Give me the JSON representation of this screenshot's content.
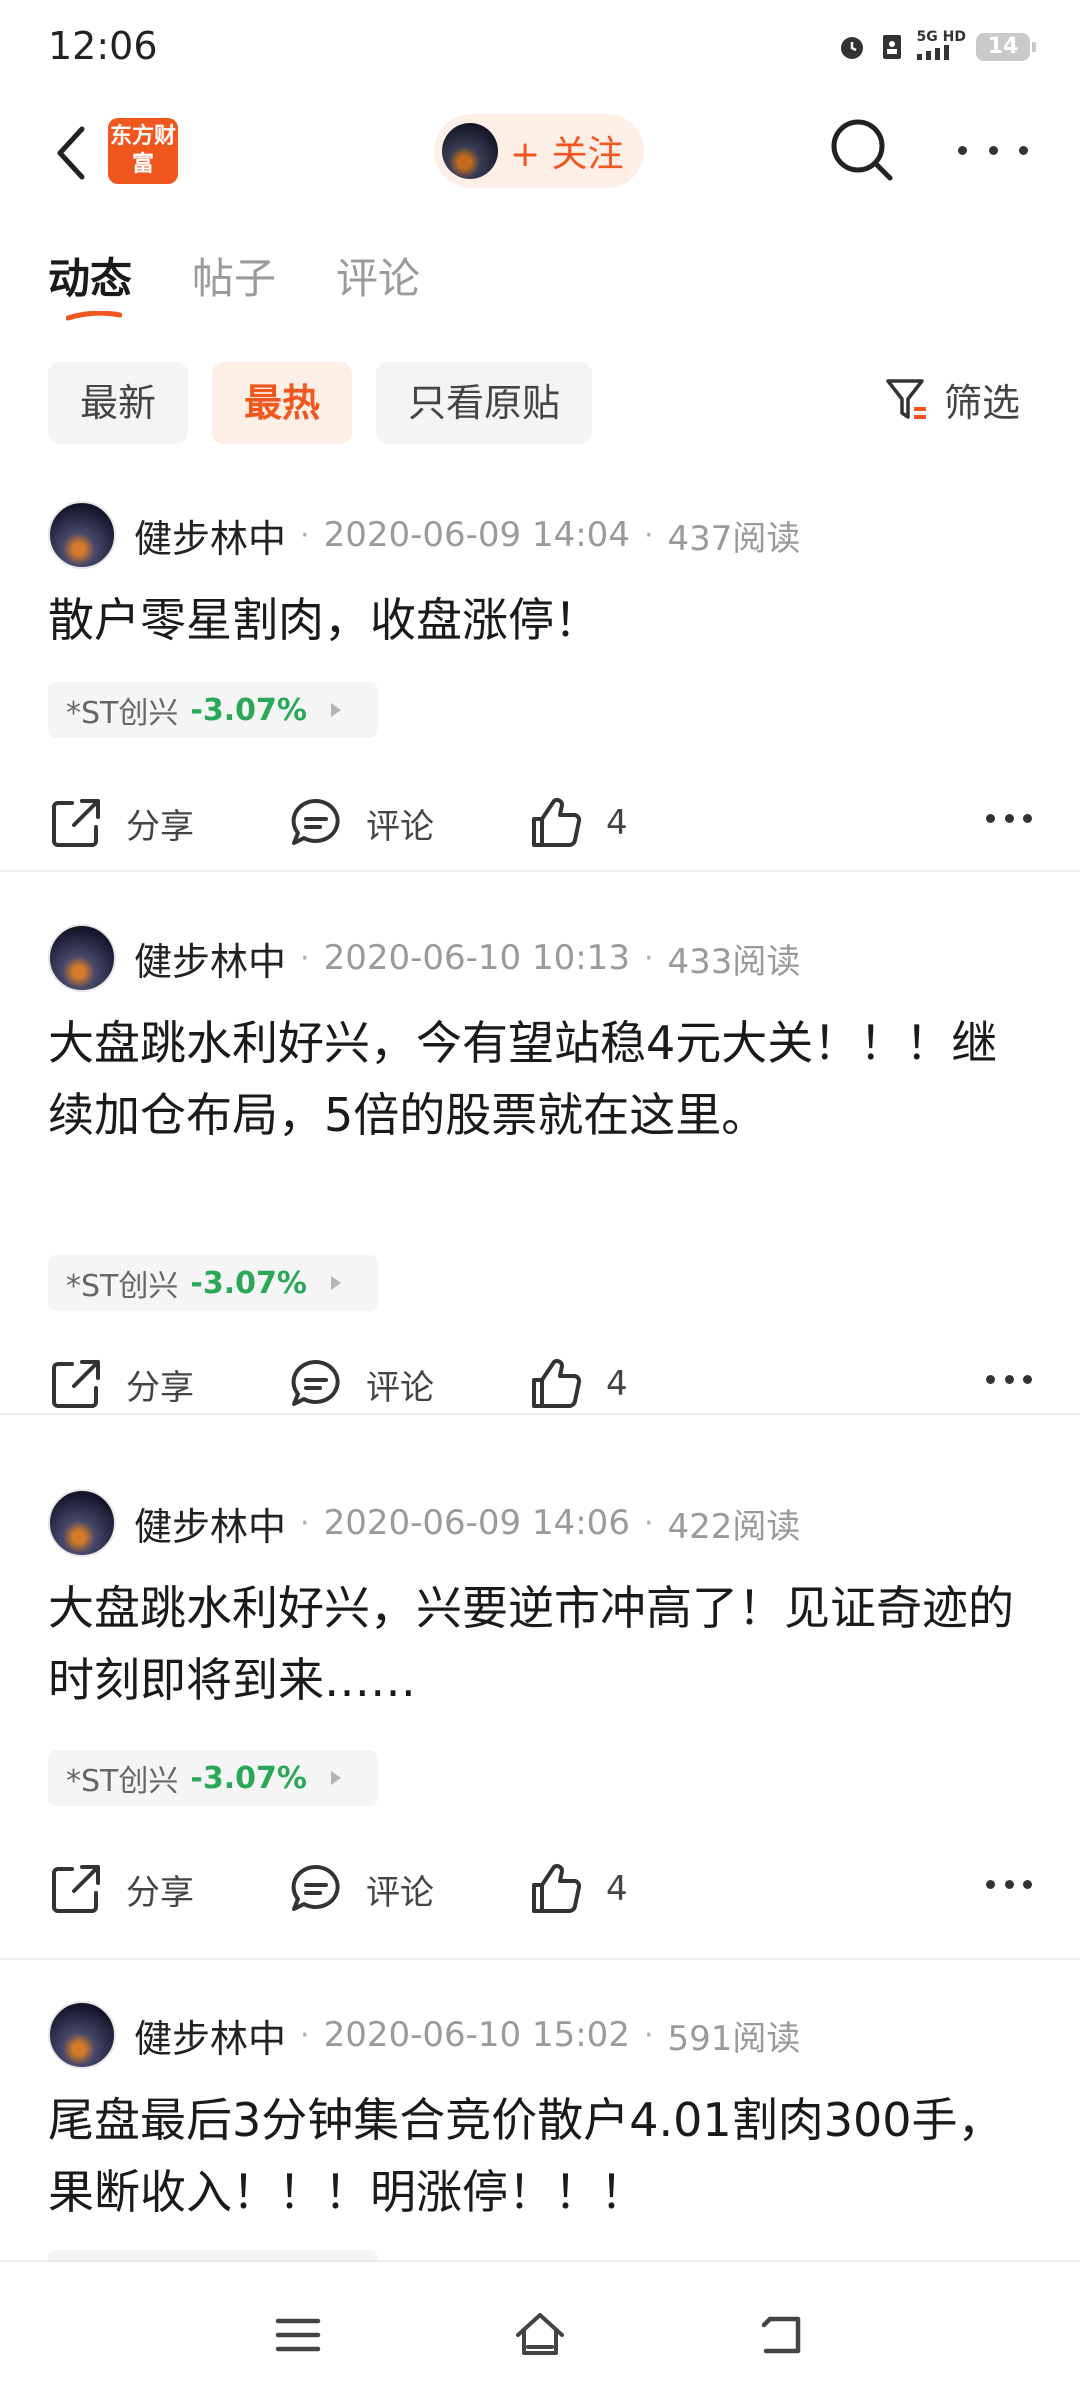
{
  "status_bar": {
    "time": "12:06",
    "network": "5G HD",
    "battery": "14"
  },
  "app_bar": {
    "logo_text": "东方财富",
    "follow_label": "+ 关注"
  },
  "main_tabs": [
    {
      "label": "动态",
      "active": true
    },
    {
      "label": "帖子",
      "active": false
    },
    {
      "label": "评论",
      "active": false
    }
  ],
  "filters": {
    "chips": [
      {
        "label": "最新",
        "active": false
      },
      {
        "label": "最热",
        "active": true
      },
      {
        "label": "只看原贴",
        "active": false
      }
    ],
    "filter_label": "筛选"
  },
  "colors": {
    "accent": "#f0571f",
    "stock_down": "#2aa858"
  },
  "actions": {
    "share_label": "分享",
    "comment_label": "评论"
  },
  "posts": [
    {
      "author": "健步林中",
      "date": "2020-06-09 14:04",
      "reads": "437阅读",
      "text": "散户零星割肉，收盘涨停！",
      "stock_name": "*ST创兴",
      "stock_change": "-3.07%",
      "likes": "4"
    },
    {
      "author": "健步林中",
      "date": "2020-06-10 10:13",
      "reads": "433阅读",
      "text": "大盘跳水利好兴，今有望站稳4元大关！！！继续加仓布局，5倍的股票就在这里。",
      "stock_name": "*ST创兴",
      "stock_change": "-3.07%",
      "likes": "4"
    },
    {
      "author": "健步林中",
      "date": "2020-06-09 14:06",
      "reads": "422阅读",
      "text": "大盘跳水利好兴，兴要逆市冲高了！见证奇迹的时刻即将到来……",
      "stock_name": "*ST创兴",
      "stock_change": "-3.07%",
      "likes": "4"
    },
    {
      "author": "健步林中",
      "date": "2020-06-10 15:02",
      "reads": "591阅读",
      "text": "尾盘最后3分钟集合竞价散户4.01割肉300手，果断收入！！！明涨停！！！"
    }
  ]
}
